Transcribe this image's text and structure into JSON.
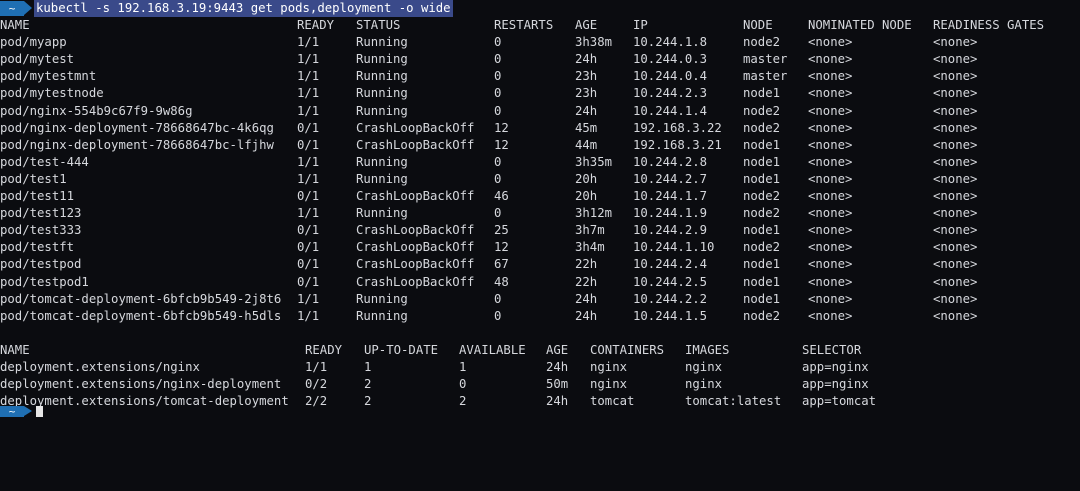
{
  "prompt": {
    "icon": "~",
    "command": "kubectl -s 192.168.3.19:9443 get pods,deployment -o wide"
  },
  "pods": {
    "headers": [
      "NAME",
      "READY",
      "STATUS",
      "RESTARTS",
      "AGE",
      "IP",
      "NODE",
      "NOMINATED NODE",
      "READINESS GATES"
    ],
    "rows": [
      [
        "pod/myapp",
        "1/1",
        "Running",
        "0",
        "3h38m",
        "10.244.1.8",
        "node2",
        "<none>",
        "<none>"
      ],
      [
        "pod/mytest",
        "1/1",
        "Running",
        "0",
        "24h",
        "10.244.0.3",
        "master",
        "<none>",
        "<none>"
      ],
      [
        "pod/mytestmnt",
        "1/1",
        "Running",
        "0",
        "23h",
        "10.244.0.4",
        "master",
        "<none>",
        "<none>"
      ],
      [
        "pod/mytestnode",
        "1/1",
        "Running",
        "0",
        "23h",
        "10.244.2.3",
        "node1",
        "<none>",
        "<none>"
      ],
      [
        "pod/nginx-554b9c67f9-9w86g",
        "1/1",
        "Running",
        "0",
        "24h",
        "10.244.1.4",
        "node2",
        "<none>",
        "<none>"
      ],
      [
        "pod/nginx-deployment-78668647bc-4k6qg",
        "0/1",
        "CrashLoopBackOff",
        "12",
        "45m",
        "192.168.3.22",
        "node2",
        "<none>",
        "<none>"
      ],
      [
        "pod/nginx-deployment-78668647bc-lfjhw",
        "0/1",
        "CrashLoopBackOff",
        "12",
        "44m",
        "192.168.3.21",
        "node1",
        "<none>",
        "<none>"
      ],
      [
        "pod/test-444",
        "1/1",
        "Running",
        "0",
        "3h35m",
        "10.244.2.8",
        "node1",
        "<none>",
        "<none>"
      ],
      [
        "pod/test1",
        "1/1",
        "Running",
        "0",
        "20h",
        "10.244.2.7",
        "node1",
        "<none>",
        "<none>"
      ],
      [
        "pod/test11",
        "0/1",
        "CrashLoopBackOff",
        "46",
        "20h",
        "10.244.1.7",
        "node2",
        "<none>",
        "<none>"
      ],
      [
        "pod/test123",
        "1/1",
        "Running",
        "0",
        "3h12m",
        "10.244.1.9",
        "node2",
        "<none>",
        "<none>"
      ],
      [
        "pod/test333",
        "0/1",
        "CrashLoopBackOff",
        "25",
        "3h7m",
        "10.244.2.9",
        "node1",
        "<none>",
        "<none>"
      ],
      [
        "pod/testft",
        "0/1",
        "CrashLoopBackOff",
        "12",
        "3h4m",
        "10.244.1.10",
        "node2",
        "<none>",
        "<none>"
      ],
      [
        "pod/testpod",
        "0/1",
        "CrashLoopBackOff",
        "67",
        "22h",
        "10.244.2.4",
        "node1",
        "<none>",
        "<none>"
      ],
      [
        "pod/testpod1",
        "0/1",
        "CrashLoopBackOff",
        "48",
        "22h",
        "10.244.2.5",
        "node1",
        "<none>",
        "<none>"
      ],
      [
        "pod/tomcat-deployment-6bfcb9b549-2j8t6",
        "1/1",
        "Running",
        "0",
        "24h",
        "10.244.2.2",
        "node1",
        "<none>",
        "<none>"
      ],
      [
        "pod/tomcat-deployment-6bfcb9b549-h5dls",
        "1/1",
        "Running",
        "0",
        "24h",
        "10.244.1.5",
        "node2",
        "<none>",
        "<none>"
      ]
    ]
  },
  "deployments": {
    "headers": [
      "NAME",
      "READY",
      "UP-TO-DATE",
      "AVAILABLE",
      "AGE",
      "CONTAINERS",
      "IMAGES",
      "SELECTOR"
    ],
    "rows": [
      [
        "deployment.extensions/nginx",
        "1/1",
        "1",
        "1",
        "24h",
        "nginx",
        "nginx",
        "app=nginx"
      ],
      [
        "deployment.extensions/nginx-deployment",
        "0/2",
        "2",
        "0",
        "50m",
        "nginx",
        "nginx",
        "app=nginx"
      ],
      [
        "deployment.extensions/tomcat-deployment",
        "2/2",
        "2",
        "2",
        "24h",
        "tomcat",
        "tomcat:latest",
        "app=tomcat"
      ]
    ]
  }
}
